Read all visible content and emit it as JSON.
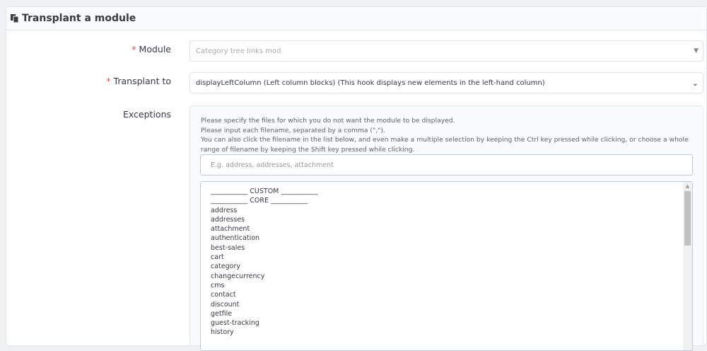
{
  "panel": {
    "title": "Transplant a module",
    "icon": "copy-icon"
  },
  "module": {
    "label": "Module",
    "required": "*",
    "placeholder": "Category tree links mod"
  },
  "transplant": {
    "label": "Transplant to",
    "required": "*",
    "value": "displayLeftColumn (Left column blocks) (This hook displays new elements in the left-hand column)"
  },
  "exceptions": {
    "label": "Exceptions",
    "help": [
      "Please specify the files for which you do not want the module to be displayed.",
      "Please input each filename, separated by a comma (\",\").",
      "You can also click the filename in the list below, and even make a multiple selection by keeping the Ctrl key pressed while clicking, or choose a whole range of filename by keeping the Shift key pressed while clicking."
    ],
    "input_placeholder": "E.g. address, addresses, attachment",
    "items": [
      "___________ CUSTOM ___________",
      "___________ CORE ___________",
      "address",
      "addresses",
      "attachment",
      "authentication",
      "best-sales",
      "cart",
      "category",
      "changecurrency",
      "cms",
      "contact",
      "discount",
      "getfile",
      "guest-tracking",
      "history"
    ]
  }
}
